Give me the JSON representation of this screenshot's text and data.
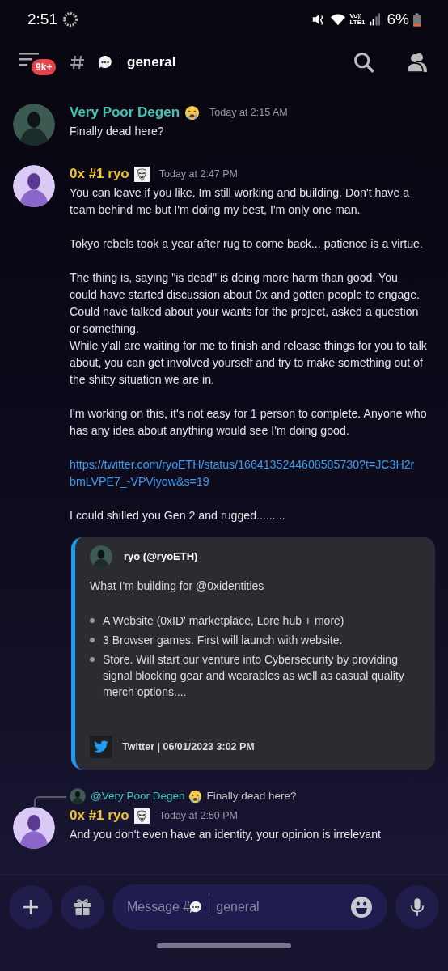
{
  "status_bar": {
    "time": "2:51",
    "network_top": "Vo))",
    "network_bottom": "LTE1",
    "battery": "6%"
  },
  "header": {
    "badge": "9k+",
    "channel": "general"
  },
  "messages": [
    {
      "author": "Very Poor Degen",
      "color": "#3fc7b4",
      "time": "Today at 2:15 AM",
      "blocks": [
        {
          "kind": "text",
          "text": "Finally dead here?"
        }
      ]
    },
    {
      "author": "0x #1 ryo",
      "color": "#f0c232",
      "time": "Today at 2:47 PM",
      "blocks": [
        {
          "kind": "text",
          "text": "You can leave if you like. Im still working and building. Don't have a team behind me but I'm doing my best, I'm only one man."
        },
        {
          "kind": "gap"
        },
        {
          "kind": "text",
          "text": "Tokyo rebels took a year after rug to come back... patience is a virtue."
        },
        {
          "kind": "gap"
        },
        {
          "kind": "text",
          "text": "The thing is, saying \"is dead\" is doing more harm than good. You could have started discussion about 0x and gotten people to engage. Could have talked about your wants for the project, asked a question or something."
        },
        {
          "kind": "text",
          "text": "While y'all are waiting for me to finish and release things for you to talk about, you can get involved yourself and try to make something out of the shitty situation we are in."
        },
        {
          "kind": "gap"
        },
        {
          "kind": "text",
          "text": "I'm working on this, it's not easy for 1 person to complete. Anyone who has any idea about anything would see I'm doing good."
        },
        {
          "kind": "gap"
        },
        {
          "kind": "link",
          "text": "https://twitter.com/ryoETH/status/1664135244608585730?t=JC3H2rbmLVPE7_-VPViyow&s=19"
        },
        {
          "kind": "gap"
        },
        {
          "kind": "text",
          "text": "I could shilled you Gen 2 and rugged........."
        }
      ],
      "embed": {
        "author": "ryo (@ryoETH)",
        "text": "What I'm building for @0xidentities",
        "bullets": [
          "A Website (0xID' marketplace, Lore hub + more)",
          "3 Browser games. First will launch with website.",
          "Store. Will start our venture into Cybersecurity by providing signal blocking gear and wearables as well as casual quality merch options...."
        ],
        "footer": "Twitter | 06/01/2023 3:02 PM"
      }
    },
    {
      "reply": {
        "author": "@Very Poor Degen",
        "color": "#3fc7b4",
        "text": "Finally dead here?"
      },
      "author": "0x #1 ryo",
      "color": "#f0c232",
      "time": "Today at 2:50 PM",
      "blocks": [
        {
          "kind": "text",
          "text": "And you don't even have an identity, your opinion is irrelevant"
        }
      ]
    }
  ],
  "composer": {
    "placeholder_prefix": "Message #",
    "placeholder_channel": "general"
  }
}
